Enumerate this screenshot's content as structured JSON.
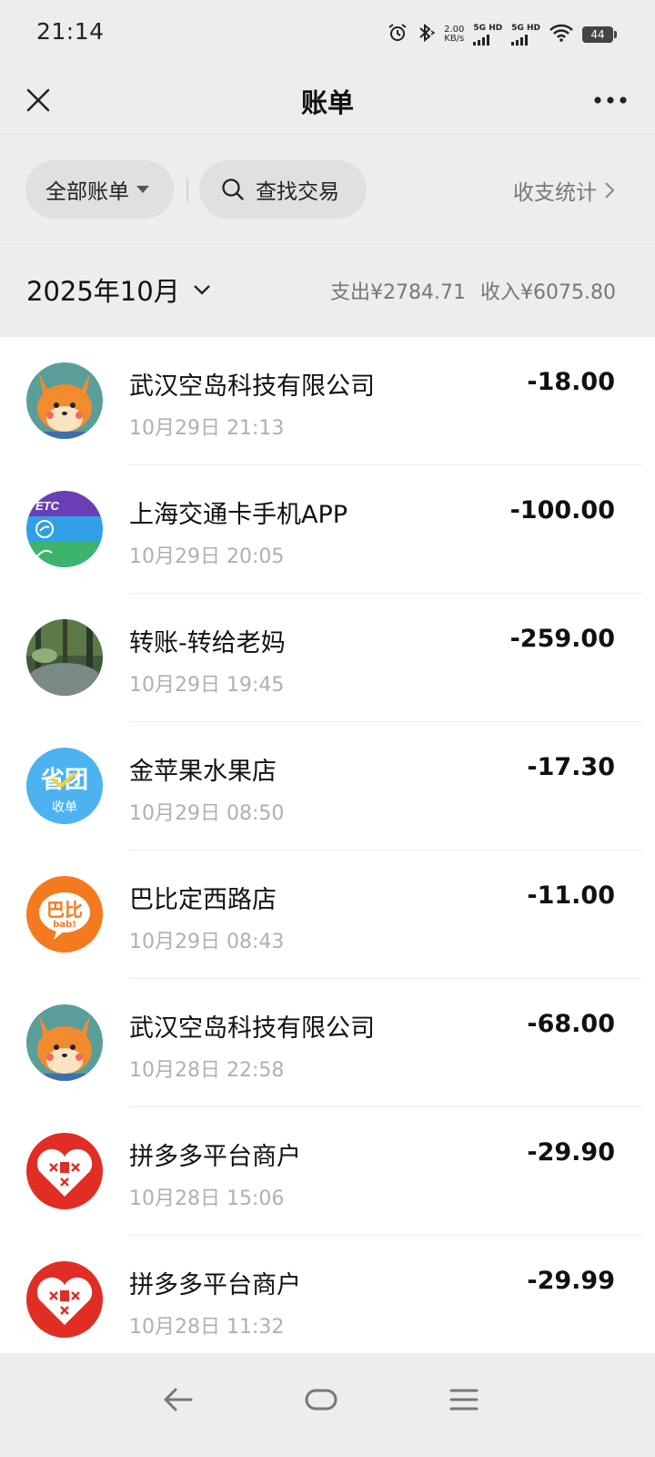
{
  "status_bar": {
    "time": "21:14",
    "network_speed_value": "2.00",
    "network_speed_unit": "KB/s",
    "signal1_label": "5G HD",
    "signal2_label": "5G HD",
    "battery": "44",
    "icons": [
      "alarm-icon",
      "bluetooth-icon",
      "wifi-icon"
    ]
  },
  "header": {
    "title": "账单",
    "close_icon": "close-icon",
    "more_icon": "more-icon"
  },
  "filters": {
    "all_bills_label": "全部账单",
    "search_label": "查找交易",
    "stats_label": "收支统计"
  },
  "month": {
    "label": "2025年10月",
    "expense_summary": "支出¥2784.71",
    "income_summary": "收入¥6075.80"
  },
  "transactions": [
    {
      "merchant": "武汉空岛科技有限公司",
      "datetime": "10月29日 21:13",
      "amount": "-18.00",
      "avatar": "fox-avatar"
    },
    {
      "merchant": "上海交通卡手机APP",
      "datetime": "10月29日 20:05",
      "amount": "-100.00",
      "avatar": "etc-transit-card-logo"
    },
    {
      "merchant": "转账-转给老妈",
      "datetime": "10月29日 19:45",
      "amount": "-259.00",
      "avatar": "forest-photo-avatar"
    },
    {
      "merchant": "金苹果水果店",
      "datetime": "10月29日 08:50",
      "amount": "-17.30",
      "avatar": "shoukuan-logo"
    },
    {
      "merchant": "巴比定西路店",
      "datetime": "10月29日 08:43",
      "amount": "-11.00",
      "avatar": "babi-logo"
    },
    {
      "merchant": "武汉空岛科技有限公司",
      "datetime": "10月28日 22:58",
      "amount": "-68.00",
      "avatar": "fox-avatar"
    },
    {
      "merchant": "拼多多平台商户",
      "datetime": "10月28日 15:06",
      "amount": "-29.90",
      "avatar": "pinduoduo-logo"
    },
    {
      "merchant": "拼多多平台商户",
      "datetime": "10月28日 11:32",
      "amount": "-29.99",
      "avatar": "pinduoduo-logo"
    }
  ],
  "logo_text": {
    "etc": "ETC",
    "shoukuan_top": "省团",
    "shoukuan_bottom": "收单",
    "babi_top": "巴比",
    "babi_bottom": "bab!"
  },
  "nav_bar": {
    "icons": [
      "back-icon",
      "home-icon",
      "menu-icon"
    ]
  },
  "colors": {
    "background": "#ededed",
    "list_background": "#ffffff",
    "secondary_text": "#b0b0b0",
    "pinduoduo_red": "#e02e24",
    "babi_orange": "#f47a20"
  }
}
